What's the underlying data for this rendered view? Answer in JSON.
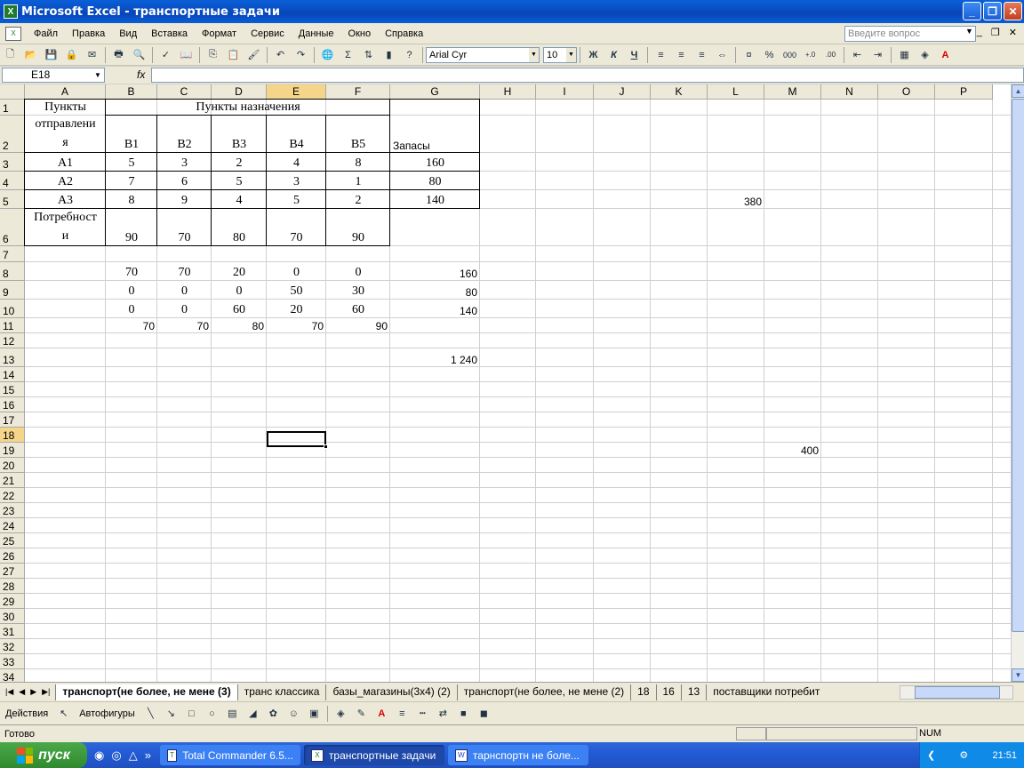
{
  "window": {
    "title": "Microsoft Excel - транспортные задачи",
    "app_icon": "excel-icon"
  },
  "menu": {
    "items": [
      "Файл",
      "Правка",
      "Вид",
      "Вставка",
      "Формат",
      "Сервис",
      "Данные",
      "Окно",
      "Справка"
    ],
    "help_placeholder": "Введите вопрос"
  },
  "toolbar": {
    "font_name": "Arial Cyr",
    "font_size": "10",
    "bold": "Ж",
    "italic": "К",
    "underline": "Ч",
    "autosum": "Σ",
    "percent": "%",
    "thousands": "000"
  },
  "formula_bar": {
    "name_box": "E18",
    "fx": "fx",
    "formula": ""
  },
  "columns": [
    "A",
    "B",
    "C",
    "D",
    "E",
    "F",
    "G",
    "H",
    "I",
    "J",
    "K",
    "L",
    "M",
    "N",
    "O",
    "P"
  ],
  "active_column": "E",
  "rows": [
    "1",
    "2",
    "3",
    "4",
    "5",
    "6",
    "7",
    "8",
    "9",
    "10",
    "11",
    "12",
    "13",
    "14",
    "15",
    "16",
    "17",
    "18",
    "19",
    "20",
    "21",
    "22",
    "23",
    "24",
    "25",
    "26",
    "27",
    "28",
    "29",
    "30",
    "31",
    "32",
    "33",
    "34"
  ],
  "active_row": "18",
  "sheet": {
    "A1": "Пункты",
    "B1": "Пункты назначения",
    "A2a": "отправлени",
    "A2b": "я",
    "B2": "В1",
    "C2": "В2",
    "D2": "В3",
    "E2": "В4",
    "F2": "В5",
    "G2": "Запасы",
    "A3": "А1",
    "B3": "5",
    "C3": "3",
    "D3": "2",
    "E3": "4",
    "F3": "8",
    "G3": "160",
    "A4": "А2",
    "B4": "7",
    "C4": "6",
    "D4": "5",
    "E4": "3",
    "F4": "1",
    "G4": "80",
    "A5": "А3",
    "B5": "8",
    "C5": "9",
    "D5": "4",
    "E5": "5",
    "F5": "2",
    "G5": "140",
    "L5": "380",
    "A6a": "Потребност",
    "A6b": "и",
    "B6": "90",
    "C6": "70",
    "D6": "80",
    "E6": "70",
    "F6": "90",
    "B8": "70",
    "C8": "70",
    "D8": "20",
    "E8": "0",
    "F8": "0",
    "G8": "160",
    "B9": "0",
    "C9": "0",
    "D9": "0",
    "E9": "50",
    "F9": "30",
    "G9": "80",
    "B10": "0",
    "C10": "0",
    "D10": "60",
    "E10": "20",
    "F10": "60",
    "G10": "140",
    "B11": "70",
    "C11": "70",
    "D11": "80",
    "E11": "70",
    "F11": "90",
    "G13": "1 240",
    "M19": "400"
  },
  "tabs": [
    "транспорт(не более, не мене (3)",
    "транс классика",
    "базы_магазины(3х4) (2)",
    "транспорт(не более, не мене (2)",
    "18",
    "16",
    "13",
    "поставщики потребит"
  ],
  "active_tab": "транспорт(не более, не мене (3)",
  "drawing_toolbar": {
    "actions": "Действия",
    "autoshapes": "Автофигуры"
  },
  "status": {
    "ready": "Готово",
    "num": "NUM"
  },
  "taskbar": {
    "start": "пуск",
    "tasks": [
      "Total Commander 6.5...",
      "транспортные задачи",
      "тарнспортн не боле..."
    ],
    "active_task": "транспортные задачи",
    "lang": "RU",
    "clock": "21:51"
  }
}
